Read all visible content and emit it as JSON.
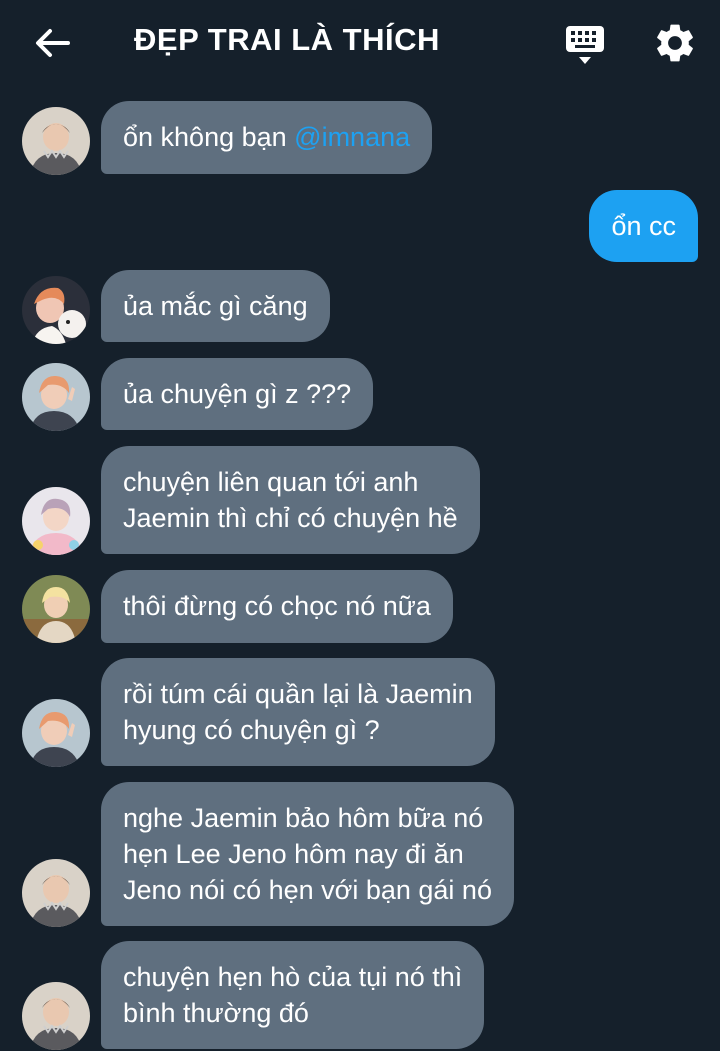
{
  "header": {
    "title": "ĐẸP TRAI LÀ THÍCH",
    "back_icon": "arrow-left-icon",
    "keyboard_icon": "keyboard-icon",
    "settings_icon": "gear-icon"
  },
  "colors": {
    "background": "#15202b",
    "bubble_incoming": "#5f6f7f",
    "bubble_outgoing": "#1da1f2",
    "mention": "#1da1f2"
  },
  "messages": [
    {
      "sender": "other",
      "text": "ổn không bạn ",
      "mention": "@imnana"
    },
    {
      "sender": "me",
      "text": "ổn cc"
    },
    {
      "sender": "other",
      "text": "ủa mắc gì căng"
    },
    {
      "sender": "other",
      "text": "ủa chuyện gì z ???"
    },
    {
      "sender": "other",
      "lines": [
        "chuyện liên quan tới anh",
        "Jaemin thì chỉ có chuyện hề"
      ]
    },
    {
      "sender": "other",
      "text": "thôi đừng có chọc nó nữa"
    },
    {
      "sender": "other",
      "lines": [
        "rồi túm cái quần lại là Jaemin",
        "hyung có chuyện gì ?"
      ]
    },
    {
      "sender": "other",
      "lines": [
        "nghe Jaemin bảo hôm bữa nó",
        "hẹn Lee Jeno hôm nay đi ăn",
        "Jeno nói có hẹn với bạn gái nó"
      ]
    },
    {
      "sender": "other",
      "lines": [
        "chuyện hẹn hò của tụi nó thì",
        "bình thường đó"
      ]
    }
  ]
}
